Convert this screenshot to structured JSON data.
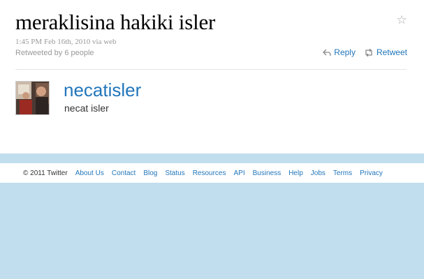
{
  "tweet": {
    "text": "meraklisina hakiki isler",
    "meta": "1:45 PM Feb 16th, 2010 via web",
    "retweeted_by": "Retweeted by 6 people"
  },
  "actions": {
    "reply": "Reply",
    "retweet": "Retweet"
  },
  "user": {
    "screen_name": "necatisler",
    "real_name": "necat isler"
  },
  "footer": {
    "copyright": "© 2011 Twitter",
    "links": [
      "About Us",
      "Contact",
      "Blog",
      "Status",
      "Resources",
      "API",
      "Business",
      "Help",
      "Jobs",
      "Terms",
      "Privacy"
    ]
  },
  "colors": {
    "link": "#2276bb",
    "background": "#c0deed"
  }
}
